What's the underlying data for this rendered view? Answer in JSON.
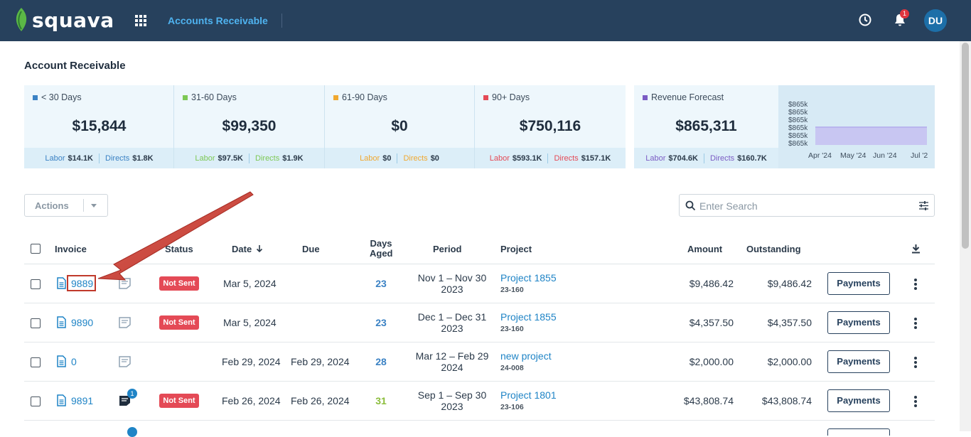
{
  "app": {
    "brand": "squava",
    "title": "Accounts Receivable",
    "avatar_initials": "DU",
    "notifications_count": "1"
  },
  "page": {
    "title": "Account Receivable"
  },
  "cards": [
    {
      "label": "< 30 Days",
      "value": "$15,844",
      "color": "#3b82c4",
      "foot": [
        {
          "label": "Labor",
          "value": "$14.1K",
          "color": "#3b82c4"
        },
        {
          "label": "Directs",
          "value": "$1.8K",
          "color": "#3b82c4"
        }
      ]
    },
    {
      "label": "31-60 Days",
      "value": "$99,350",
      "color": "#7dc855",
      "foot": [
        {
          "label": "Labor",
          "value": "$97.5K",
          "color": "#7dc855"
        },
        {
          "label": "Directs",
          "value": "$1.9K",
          "color": "#7dc855"
        }
      ]
    },
    {
      "label": "61-90 Days",
      "value": "$0",
      "color": "#f0a830",
      "foot": [
        {
          "label": "Labor",
          "value": "$0",
          "color": "#f0a830"
        },
        {
          "label": "Directs",
          "value": "$0",
          "color": "#f0a830"
        }
      ]
    },
    {
      "label": "90+ Days",
      "value": "$750,116",
      "color": "#e44a56",
      "foot": [
        {
          "label": "Labor",
          "value": "$593.1K",
          "color": "#e44a56"
        },
        {
          "label": "Directs",
          "value": "$157.1K",
          "color": "#e44a56"
        }
      ]
    },
    {
      "label": "Revenue Forecast",
      "value": "$865,311",
      "color": "#7b5cc4",
      "foot": [
        {
          "label": "Labor",
          "value": "$704.6K",
          "color": "#7b5cc4"
        },
        {
          "label": "Directs",
          "value": "$160.7K",
          "color": "#7b5cc4"
        }
      ]
    }
  ],
  "chart_data": {
    "type": "bar",
    "categories": [
      "Apr '24",
      "May '24",
      "Jun '24",
      "Jul '2"
    ],
    "y_tick_labels": [
      "$865k",
      "$865k",
      "$865k",
      "$865k",
      "$865k",
      "$865k"
    ],
    "values": [
      865311,
      865311,
      865311,
      865311
    ],
    "color": "#c8c6f2",
    "title": "",
    "xlabel": "",
    "ylabel": ""
  },
  "toolbar": {
    "actions_label": "Actions",
    "search_placeholder": "Enter Search"
  },
  "table": {
    "headers": {
      "invoice": "Invoice",
      "status": "Status",
      "date": "Date",
      "due": "Due",
      "days_aged_1": "Days",
      "days_aged_2": "Aged",
      "period": "Period",
      "project": "Project",
      "amount": "Amount",
      "outstanding": "Outstanding"
    },
    "payments_label": "Payments",
    "rows": [
      {
        "invoice": "9889",
        "status": "Not Sent",
        "date": "Mar 5, 2024",
        "due": "",
        "days": "23",
        "days_color": "#3b82c4",
        "period_1": "Nov 1 – Nov 30",
        "period_2": "2023",
        "project": "Project 1855",
        "code": "23-160",
        "amount": "$9,486.42",
        "outstanding": "$9,486.42",
        "note_count": ""
      },
      {
        "invoice": "9890",
        "status": "Not Sent",
        "date": "Mar 5, 2024",
        "due": "",
        "days": "23",
        "days_color": "#3b82c4",
        "period_1": "Dec 1 – Dec 31",
        "period_2": "2023",
        "project": "Project 1855",
        "code": "23-160",
        "amount": "$4,357.50",
        "outstanding": "$4,357.50",
        "note_count": ""
      },
      {
        "invoice": "0",
        "status": "",
        "date": "Feb 29, 2024",
        "due": "Feb 29, 2024",
        "days": "28",
        "days_color": "#3b82c4",
        "period_1": "Mar 12 – Feb 29",
        "period_2": "2024",
        "project": "new project",
        "code": "24-008",
        "amount": "$2,000.00",
        "outstanding": "$2,000.00",
        "note_count": ""
      },
      {
        "invoice": "9891",
        "status": "Not Sent",
        "date": "Feb 26, 2024",
        "due": "Feb 26, 2024",
        "days": "31",
        "days_color": "#8bbd3c",
        "period_1": "Sep 1 – Sep 30",
        "period_2": "2023",
        "project": "Project 1801",
        "code": "23-106",
        "amount": "$43,808.74",
        "outstanding": "$43,808.74",
        "note_count": "1"
      }
    ]
  }
}
